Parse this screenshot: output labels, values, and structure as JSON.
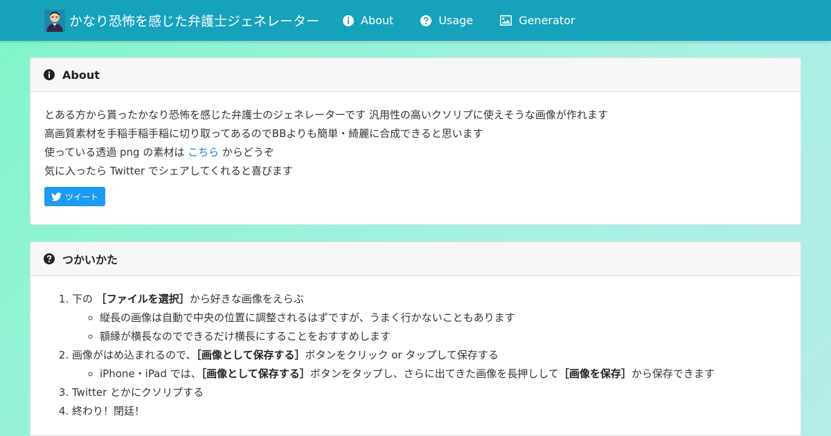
{
  "navbar": {
    "brand": "かなり恐怖を感じた弁護士ジェネレーター",
    "items": [
      {
        "label": "About",
        "icon": "info-circle-icon"
      },
      {
        "label": "Usage",
        "icon": "question-circle-icon"
      },
      {
        "label": "Generator",
        "icon": "image-icon"
      }
    ]
  },
  "about": {
    "title": "About",
    "line1": "とある方から貰ったかなり恐怖を感じた弁護士のジェネレーターです 汎用性の高いクソリプに使えそうな画像が作れます",
    "line2": "高画質素材を手稲手稲手稲に切り取ってあるのでBBよりも簡単・綺麗に合成できると思います",
    "line3_pre": "使っている透過 png の素材は ",
    "line3_link": "こちら",
    "line3_post": " からどうぞ",
    "line4": "気に入ったら Twitter でシェアしてくれると喜びます",
    "tweet_label": "ツイート"
  },
  "usage": {
    "title": "つかいかた",
    "step1_pre": "下の ",
    "step1_bold": "［ファイルを選択］",
    "step1_post": "から好きな画像をえらぶ",
    "step1_sub1": "縦長の画像は自動で中央の位置に調整されるはずですが、うまく行かないこともあります",
    "step1_sub2": "額縁が横長なのでできるだけ横長にすることをおすすめします",
    "step2_pre": "画像がはめ込まれるので、",
    "step2_bold": "［画像として保存する］",
    "step2_post": "ボタンをクリック or タップして保存する",
    "step2_sub_pre": "iPhone・iPad では、",
    "step2_sub_bold1": "［画像として保存する］",
    "step2_sub_mid": "ボタンをタップし、さらに出てきた画像を長押しして",
    "step2_sub_bold2": "［画像を保存］",
    "step2_sub_post": "から保存できます",
    "step3": "Twitter とかにクソリプする",
    "step4": "終わり！閉廷！"
  },
  "colors": {
    "navbar": "#17a2bb",
    "link": "#1a7bd1",
    "tweet_button": "#1d9bf0"
  }
}
